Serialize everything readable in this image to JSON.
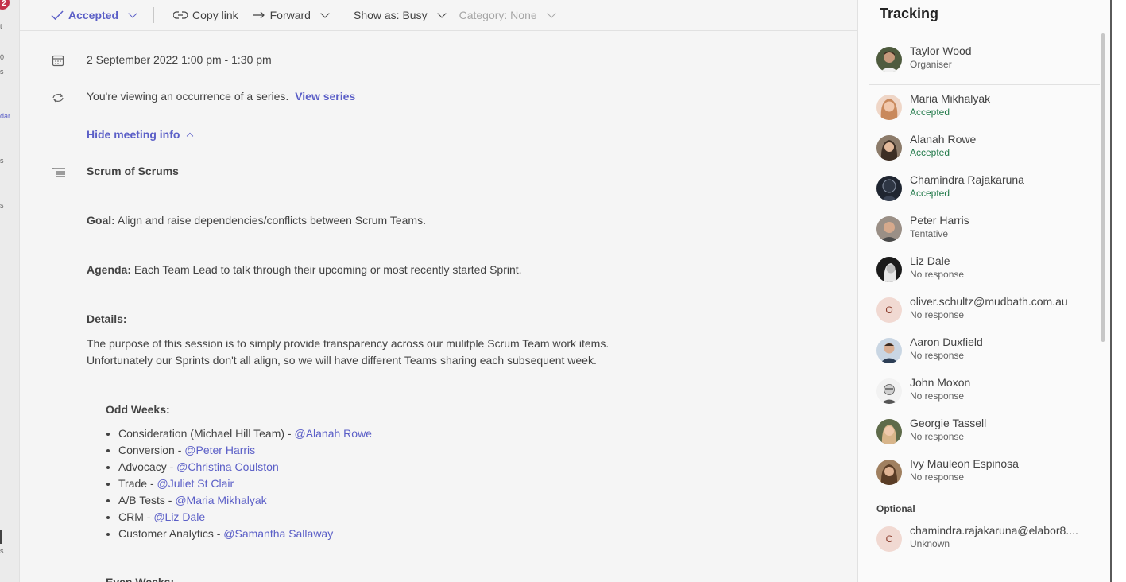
{
  "rail": {
    "badge": "2",
    "fragments": [
      "t",
      "0",
      "s",
      "dar",
      "s",
      "s",
      "s"
    ]
  },
  "toolbar": {
    "accepted": "Accepted",
    "copy_link": "Copy link",
    "forward": "Forward",
    "show_as": "Show as: Busy",
    "category": "Category: None"
  },
  "meeting": {
    "datetime": "2 September 2022 1:00 pm - 1:30 pm",
    "series_text": "You're viewing an occurrence of a series.",
    "view_series": "View series",
    "hide_info": "Hide meeting info",
    "title": "Scrum of Scrums",
    "goal_label": "Goal:",
    "goal_text": " Align and raise dependencies/conflicts between Scrum Teams.",
    "agenda_label": "Agenda:",
    "agenda_text": " Each Team Lead to talk through their upcoming or most recently started Sprint.",
    "details_label": "Details:",
    "details_line1": "The purpose of this session is to simply provide transparency across our mulitple Scrum Team work items.",
    "details_line2": "Unfortunately our Sprints don't all align, so we will have different Teams sharing each subsequent week.",
    "odd_weeks_label": "Odd Weeks:",
    "odd_weeks": [
      {
        "text": "Consideration (Michael Hill Team) - ",
        "mention": "@Alanah Rowe"
      },
      {
        "text": "Conversion - ",
        "mention": "@Peter Harris"
      },
      {
        "text": "Advocacy - ",
        "mention": "@Christina Coulston"
      },
      {
        "text": "Trade - ",
        "mention": "@Juliet St Clair"
      },
      {
        "text": "A/B Tests - ",
        "mention": "@Maria Mikhalyak"
      },
      {
        "text": "CRM - ",
        "mention": "@Liz Dale"
      },
      {
        "text": "Customer Analytics - ",
        "mention": "@Samantha Sallaway"
      }
    ],
    "even_weeks_label": "Even Weeks:"
  },
  "tracking": {
    "title": "Tracking",
    "organiser": {
      "name": "Taylor Wood",
      "status": "Organiser"
    },
    "attendees": [
      {
        "name": "Maria Mikhalyak",
        "status": "Accepted"
      },
      {
        "name": "Alanah Rowe",
        "status": "Accepted"
      },
      {
        "name": "Chamindra Rajakaruna",
        "status": "Accepted"
      },
      {
        "name": "Peter Harris",
        "status": "Tentative"
      },
      {
        "name": "Liz Dale",
        "status": "No response"
      },
      {
        "name": "oliver.schultz@mudbath.com.au",
        "status": "No response",
        "initial": "O"
      },
      {
        "name": "Aaron Duxfield",
        "status": "No response"
      },
      {
        "name": "John Moxon",
        "status": "No response"
      },
      {
        "name": "Georgie Tassell",
        "status": "No response"
      },
      {
        "name": "Ivy Mauleon Espinosa",
        "status": "No response"
      }
    ],
    "optional_label": "Optional",
    "optional": [
      {
        "name": "chamindra.rajakaruna@elabor8....",
        "status": "Unknown",
        "initial": "C"
      }
    ]
  },
  "colors": {
    "accent": "#5b5fc7",
    "accepted": "#237b4b",
    "badge": "#c4314b"
  }
}
